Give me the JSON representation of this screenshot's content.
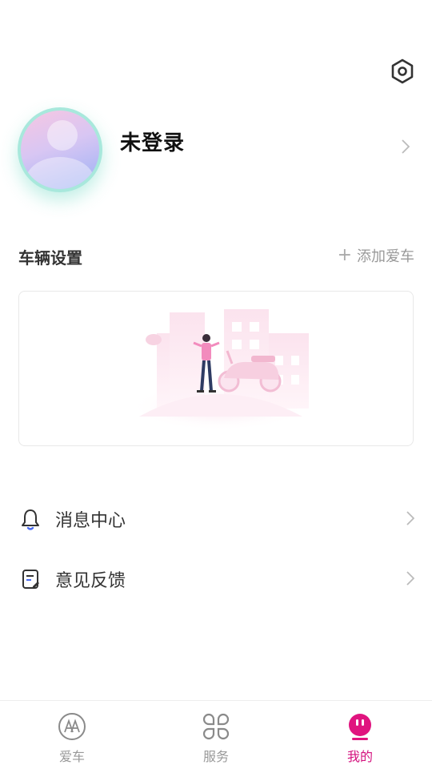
{
  "header": {
    "settings_icon": "hexagon-gear-icon"
  },
  "profile": {
    "name": "未登录",
    "avatar_icon": "default-avatar",
    "chevron_icon": "chevron-right-icon"
  },
  "vehicles": {
    "section_title": "车辆设置",
    "add_button": {
      "icon": "plus-icon",
      "label": "添加爱车"
    },
    "empty_illustration": "person-with-scooter-illustration"
  },
  "menu": {
    "items": [
      {
        "label": "消息中心",
        "icon": "bell-icon"
      },
      {
        "label": "意见反馈",
        "icon": "feedback-edit-icon"
      }
    ]
  },
  "tabbar": {
    "tabs": [
      {
        "label": "爱车",
        "icon": "aima-logo-icon",
        "active": false
      },
      {
        "label": "服务",
        "icon": "command-clover-icon",
        "active": false
      },
      {
        "label": "我的",
        "icon": "face-icon",
        "active": true
      }
    ]
  },
  "colors": {
    "accent": "#d4137f",
    "muted_text": "#999999",
    "avatar_ring": "#a8e8dc"
  }
}
